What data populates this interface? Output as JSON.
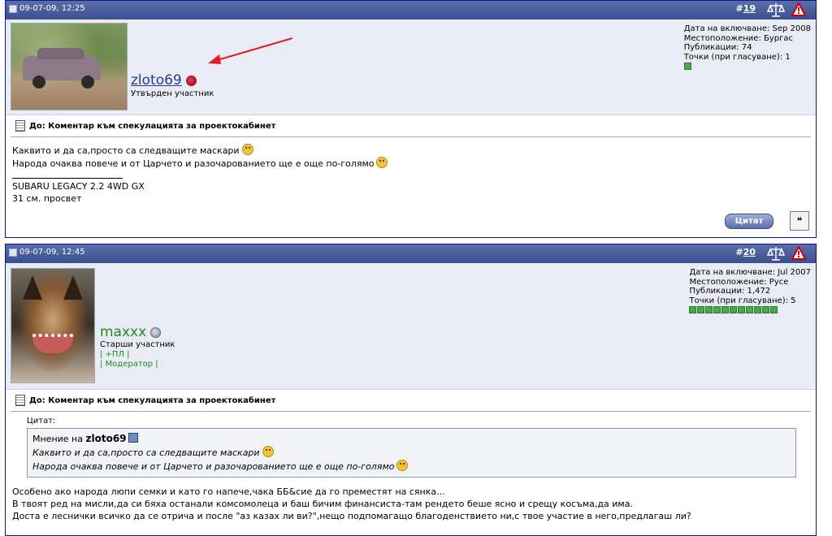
{
  "posts": [
    {
      "date": "09-07-09, 12:25",
      "number": "19",
      "username": "zloto69",
      "user_title": "Утвърден участник",
      "info": {
        "joined": "Дата на включване: Sep 2008",
        "location": "Местоположение: Бургас",
        "posts": "Публикации: 74",
        "rep": "Точки (при гласуване): 1"
      },
      "subject": "До: Коментар към спекулацията за проектокабинет",
      "body_lines": [
        "Каквито и да са,просто са следващите маскари",
        "Народа очаква повече и от Царчето и разочарованието ще е още по-голямо"
      ],
      "signature": [
        "SUBARU LEGACY 2.2 4WD GX",
        "31 см. просвет"
      ],
      "quote_button": "Цитат"
    },
    {
      "date": "09-07-09, 12:45",
      "number": "20",
      "username": "maxxx",
      "user_title": "Старши участник",
      "groups": [
        "| +ПЛ |",
        "| Модератор |"
      ],
      "info": {
        "joined": "Дата на включване: Jul 2007",
        "location": "Местоположение: Русе",
        "posts": "Публикации: 1,472",
        "rep": "Точки (при гласуване): 5"
      },
      "subject": "До: Коментар към спекулацията за проектокабинет",
      "quote": {
        "label": "Цитат:",
        "by_prefix": "Мнение на",
        "by_name": "zloto69",
        "lines": [
          "Каквито и да са,просто са следващите маскари",
          "Народа очаква повече и от Царчето и разочарованието ще е още по-голямо"
        ]
      },
      "body_lines": [
        "Особено ако народа люпи семки и като го напече,чака ББ&сие да го преместят на сянка...",
        "В твоят ред на мисли,да си бяха останали комсомолеца и баш бичим финансиста-там рендето беше ясно и срещу косъма,да има.",
        "Доста е леснички всичко да се отрича и после \"аз казах ли ви?\",нещо подпомагащо благоденствието ни,с твое участие в него,предлагаш ли?"
      ]
    }
  ],
  "colors": {
    "header_bar": "#3b4f8f",
    "user_band": "#e9ecf5",
    "annotation_arrow": "#e02020"
  }
}
